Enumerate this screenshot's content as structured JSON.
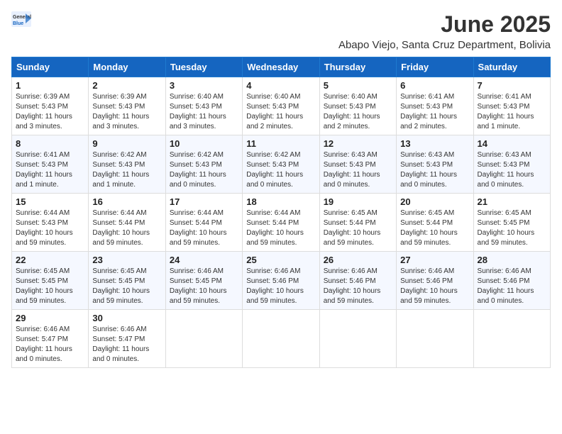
{
  "header": {
    "logo_general": "General",
    "logo_blue": "Blue",
    "month_year": "June 2025",
    "location": "Abapo Viejo, Santa Cruz Department, Bolivia"
  },
  "days_of_week": [
    "Sunday",
    "Monday",
    "Tuesday",
    "Wednesday",
    "Thursday",
    "Friday",
    "Saturday"
  ],
  "weeks": [
    [
      {
        "day": "1",
        "sunrise": "6:39 AM",
        "sunset": "5:43 PM",
        "daylight": "11 hours and 3 minutes."
      },
      {
        "day": "2",
        "sunrise": "6:39 AM",
        "sunset": "5:43 PM",
        "daylight": "11 hours and 3 minutes."
      },
      {
        "day": "3",
        "sunrise": "6:40 AM",
        "sunset": "5:43 PM",
        "daylight": "11 hours and 3 minutes."
      },
      {
        "day": "4",
        "sunrise": "6:40 AM",
        "sunset": "5:43 PM",
        "daylight": "11 hours and 2 minutes."
      },
      {
        "day": "5",
        "sunrise": "6:40 AM",
        "sunset": "5:43 PM",
        "daylight": "11 hours and 2 minutes."
      },
      {
        "day": "6",
        "sunrise": "6:41 AM",
        "sunset": "5:43 PM",
        "daylight": "11 hours and 2 minutes."
      },
      {
        "day": "7",
        "sunrise": "6:41 AM",
        "sunset": "5:43 PM",
        "daylight": "11 hours and 1 minute."
      }
    ],
    [
      {
        "day": "8",
        "sunrise": "6:41 AM",
        "sunset": "5:43 PM",
        "daylight": "11 hours and 1 minute."
      },
      {
        "day": "9",
        "sunrise": "6:42 AM",
        "sunset": "5:43 PM",
        "daylight": "11 hours and 1 minute."
      },
      {
        "day": "10",
        "sunrise": "6:42 AM",
        "sunset": "5:43 PM",
        "daylight": "11 hours and 0 minutes."
      },
      {
        "day": "11",
        "sunrise": "6:42 AM",
        "sunset": "5:43 PM",
        "daylight": "11 hours and 0 minutes."
      },
      {
        "day": "12",
        "sunrise": "6:43 AM",
        "sunset": "5:43 PM",
        "daylight": "11 hours and 0 minutes."
      },
      {
        "day": "13",
        "sunrise": "6:43 AM",
        "sunset": "5:43 PM",
        "daylight": "11 hours and 0 minutes."
      },
      {
        "day": "14",
        "sunrise": "6:43 AM",
        "sunset": "5:43 PM",
        "daylight": "11 hours and 0 minutes."
      }
    ],
    [
      {
        "day": "15",
        "sunrise": "6:44 AM",
        "sunset": "5:43 PM",
        "daylight": "10 hours and 59 minutes."
      },
      {
        "day": "16",
        "sunrise": "6:44 AM",
        "sunset": "5:44 PM",
        "daylight": "10 hours and 59 minutes."
      },
      {
        "day": "17",
        "sunrise": "6:44 AM",
        "sunset": "5:44 PM",
        "daylight": "10 hours and 59 minutes."
      },
      {
        "day": "18",
        "sunrise": "6:44 AM",
        "sunset": "5:44 PM",
        "daylight": "10 hours and 59 minutes."
      },
      {
        "day": "19",
        "sunrise": "6:45 AM",
        "sunset": "5:44 PM",
        "daylight": "10 hours and 59 minutes."
      },
      {
        "day": "20",
        "sunrise": "6:45 AM",
        "sunset": "5:44 PM",
        "daylight": "10 hours and 59 minutes."
      },
      {
        "day": "21",
        "sunrise": "6:45 AM",
        "sunset": "5:45 PM",
        "daylight": "10 hours and 59 minutes."
      }
    ],
    [
      {
        "day": "22",
        "sunrise": "6:45 AM",
        "sunset": "5:45 PM",
        "daylight": "10 hours and 59 minutes."
      },
      {
        "day": "23",
        "sunrise": "6:45 AM",
        "sunset": "5:45 PM",
        "daylight": "10 hours and 59 minutes."
      },
      {
        "day": "24",
        "sunrise": "6:46 AM",
        "sunset": "5:45 PM",
        "daylight": "10 hours and 59 minutes."
      },
      {
        "day": "25",
        "sunrise": "6:46 AM",
        "sunset": "5:46 PM",
        "daylight": "10 hours and 59 minutes."
      },
      {
        "day": "26",
        "sunrise": "6:46 AM",
        "sunset": "5:46 PM",
        "daylight": "10 hours and 59 minutes."
      },
      {
        "day": "27",
        "sunrise": "6:46 AM",
        "sunset": "5:46 PM",
        "daylight": "10 hours and 59 minutes."
      },
      {
        "day": "28",
        "sunrise": "6:46 AM",
        "sunset": "5:46 PM",
        "daylight": "11 hours and 0 minutes."
      }
    ],
    [
      {
        "day": "29",
        "sunrise": "6:46 AM",
        "sunset": "5:47 PM",
        "daylight": "11 hours and 0 minutes."
      },
      {
        "day": "30",
        "sunrise": "6:46 AM",
        "sunset": "5:47 PM",
        "daylight": "11 hours and 0 minutes."
      },
      null,
      null,
      null,
      null,
      null
    ]
  ],
  "labels": {
    "sunrise_prefix": "Sunrise: ",
    "sunset_prefix": "Sunset: ",
    "daylight_prefix": "Daylight: "
  }
}
